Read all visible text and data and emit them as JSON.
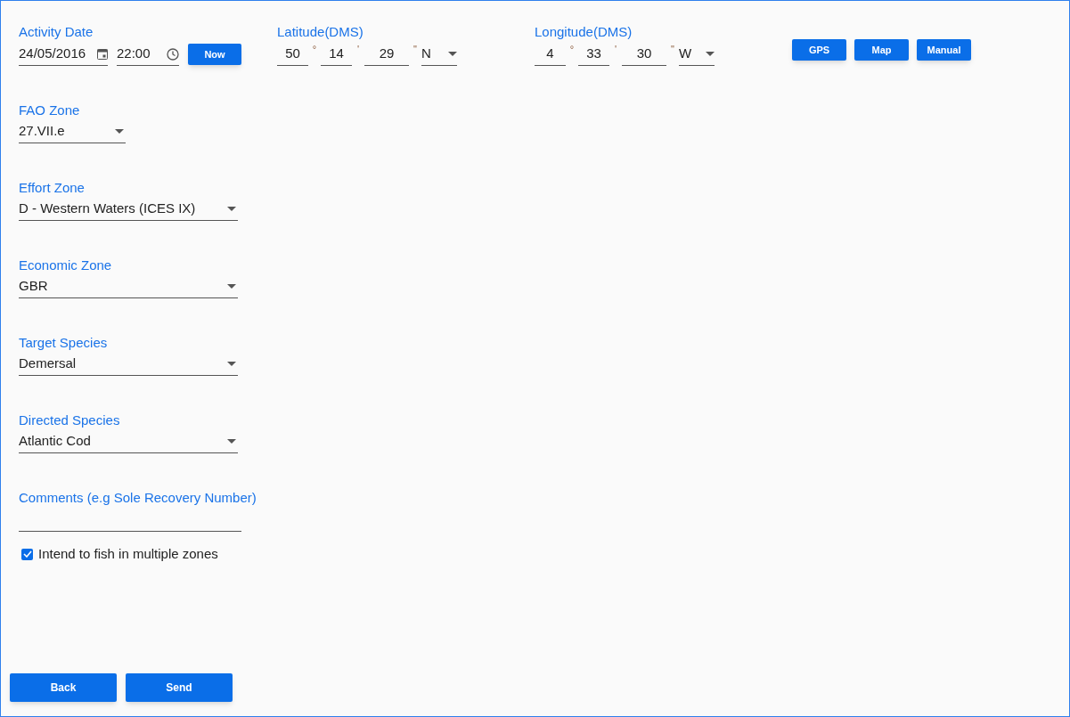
{
  "activity_date": {
    "label": "Activity Date",
    "date": "24/05/2016",
    "time": "22:00",
    "now_button": "Now"
  },
  "latitude": {
    "label": "Latitude(DMS)",
    "parts": [
      {
        "value": "50",
        "unit": "°"
      },
      {
        "value": "14",
        "unit": "'"
      },
      {
        "value": "29",
        "unit": "\""
      }
    ],
    "hemisphere": "N"
  },
  "longitude": {
    "label": "Longitude(DMS)",
    "parts": [
      {
        "value": "4",
        "unit": "°"
      },
      {
        "value": "33",
        "unit": "'"
      },
      {
        "value": "30",
        "unit": "\""
      }
    ],
    "hemisphere": "W"
  },
  "location_buttons": [
    "GPS",
    "Map",
    "Manual"
  ],
  "dropdowns": [
    {
      "label": "FAO Zone",
      "value": "27.VII.e"
    },
    {
      "label": "Effort Zone",
      "value": "D - Western Waters (ICES IX)"
    },
    {
      "label": "Economic Zone",
      "value": "GBR"
    },
    {
      "label": "Target Species",
      "value": "Demersal"
    },
    {
      "label": "Directed Species",
      "value": "Atlantic Cod"
    }
  ],
  "comments": {
    "label": "Comments (e.g Sole Recovery Number)"
  },
  "multiple_zones": {
    "label": "Intend to fish in multiple zones",
    "checked": true
  },
  "buttons": [
    "Back",
    "Send"
  ]
}
